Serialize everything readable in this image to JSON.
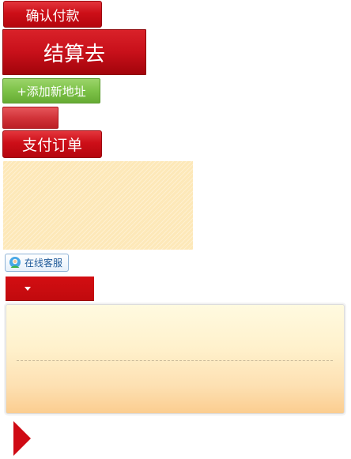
{
  "buttons": {
    "confirm_pay": "确认付款",
    "checkout": "结算去",
    "add_address": "+添加新地址",
    "pay_order": "支付订单",
    "online_support": "在线客服"
  },
  "icons": {
    "support": "customer-service-icon",
    "dropdown": "caret-down-icon",
    "arrow": "play-arrow-icon"
  },
  "colors": {
    "primary_red": "#cd0f18",
    "green": "#7dc248",
    "panel_top": "#fffae0",
    "panel_bottom": "#fbcd90",
    "stripe": "#fde8b8"
  }
}
